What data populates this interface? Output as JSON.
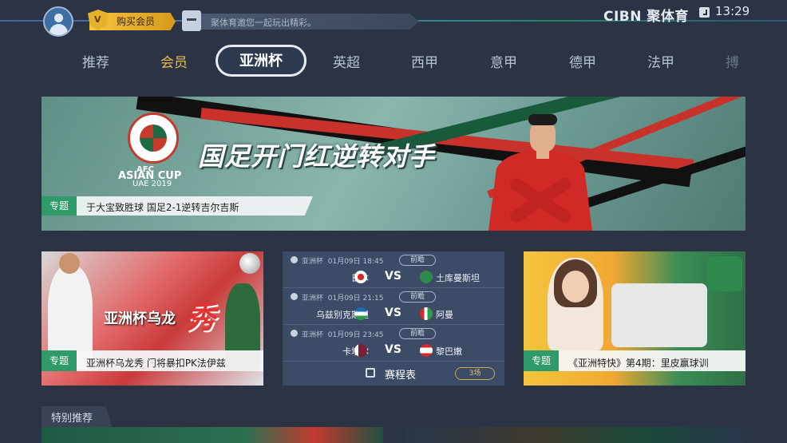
{
  "header": {
    "vip_label": "购买会员",
    "vip_shield_glyph": "V",
    "message": "聚体育邀您一起玩出精彩。",
    "brand": "CIBN 聚体育",
    "time": "13:29"
  },
  "nav": {
    "tabs": [
      {
        "label": "推荐"
      },
      {
        "label": "会员"
      },
      {
        "label": "亚洲杯"
      },
      {
        "label": "英超"
      },
      {
        "label": "西甲"
      },
      {
        "label": "意甲"
      },
      {
        "label": "德甲"
      },
      {
        "label": "法甲"
      },
      {
        "label": "搏"
      }
    ],
    "active_index": 2
  },
  "hero": {
    "logo_line1": "AFC",
    "logo_line2": "ASIAN CUP",
    "logo_line3": "UAE 2019",
    "title": "国足开门红逆转对手",
    "tag": "专题",
    "caption": "于大宝致胜球 国足2-1逆转吉尔吉斯"
  },
  "card_left": {
    "overlay_text": "亚洲杯乌龙",
    "overlay_big": "秀",
    "tag": "专题",
    "caption": "亚洲杯乌龙秀 门将暴扣PK法伊兹"
  },
  "schedule": {
    "matches": [
      {
        "competition": "亚洲杯",
        "time": "01月09日 18:45",
        "status": "前瞻",
        "home": "日本",
        "vs": "VS",
        "away": "土库曼斯坦"
      },
      {
        "competition": "亚洲杯",
        "time": "01月09日 21:15",
        "status": "前瞻",
        "home": "乌兹别克斯坦",
        "vs": "VS",
        "away": "阿曼"
      },
      {
        "competition": "亚洲杯",
        "time": "01月09日 23:45",
        "status": "前瞻",
        "home": "卡塔尔",
        "vs": "VS",
        "away": "黎巴嫩"
      }
    ],
    "footer_label": "赛程表",
    "footer_count": "3场"
  },
  "card_right": {
    "tag": "专题",
    "caption": "《亚洲特快》第4期：里皮赢球训"
  },
  "section": {
    "title": "特别推荐"
  },
  "colors": {
    "background": "#2b3345",
    "vip_gold": "#e9b949",
    "tag_green": "#2f9a6a",
    "schedule_bg": "#3c4b66"
  },
  "icons": [
    "avatar-icon",
    "vip-shield-icon",
    "message-icon",
    "clock-icon",
    "calendar-icon",
    "football-icon"
  ]
}
